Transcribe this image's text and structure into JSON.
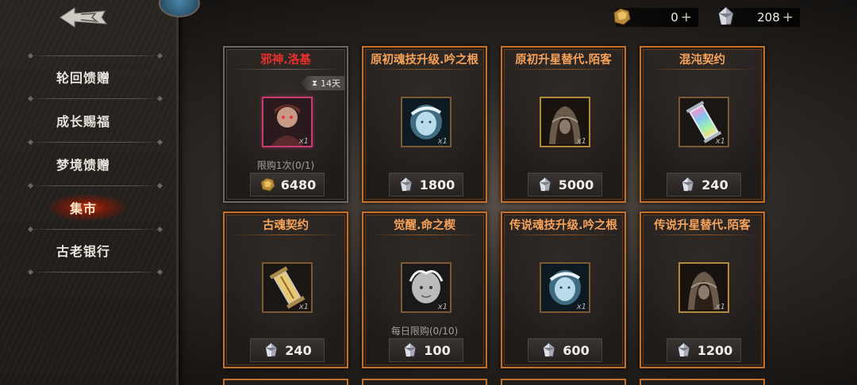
{
  "header": {
    "currencies": [
      {
        "icon": "gold-nugget-icon",
        "amount": "0"
      },
      {
        "icon": "crystal-icon",
        "amount": "208"
      }
    ],
    "plus_label": "+"
  },
  "sidebar": {
    "back_icon": "back-arrow-icon",
    "items": [
      {
        "label": "轮回馈赠",
        "active": false
      },
      {
        "label": "成长赐福",
        "active": false
      },
      {
        "label": "梦境馈赠",
        "active": false
      },
      {
        "label": "集市",
        "active": true
      },
      {
        "label": "古老银行",
        "active": false
      }
    ]
  },
  "shop": {
    "items": [
      {
        "title": "邪神.洛基",
        "featured": true,
        "timer": "14天",
        "quantity": "x1",
        "limit": "限购1次(0/1)",
        "currency": "gold-nugget-icon",
        "price": "6480",
        "art": "portrait-pink"
      },
      {
        "title": "原初魂技升级.吟之根",
        "featured": false,
        "timer": "",
        "quantity": "x1",
        "limit": "",
        "currency": "crystal-icon",
        "price": "1800",
        "art": "blue-face"
      },
      {
        "title": "原初升星替代.陌客",
        "featured": false,
        "timer": "",
        "quantity": "x1",
        "limit": "",
        "currency": "crystal-icon",
        "price": "5000",
        "art": "hooded"
      },
      {
        "title": "混沌契约",
        "featured": false,
        "timer": "",
        "quantity": "x1",
        "limit": "",
        "currency": "crystal-icon",
        "price": "240",
        "art": "rainbow-scroll"
      },
      {
        "title": "古魂契约",
        "featured": false,
        "timer": "",
        "quantity": "x1",
        "limit": "",
        "currency": "crystal-icon",
        "price": "240",
        "art": "gold-scroll"
      },
      {
        "title": "觉醒.命之楔",
        "featured": false,
        "timer": "",
        "quantity": "x1",
        "limit": "每日限购(0/10)",
        "currency": "crystal-icon",
        "price": "100",
        "art": "silver-face"
      },
      {
        "title": "传说魂技升级.吟之根",
        "featured": false,
        "timer": "",
        "quantity": "x1",
        "limit": "",
        "currency": "crystal-icon",
        "price": "600",
        "art": "blue-face"
      },
      {
        "title": "传说升星替代.陌客",
        "featured": false,
        "timer": "",
        "quantity": "x1",
        "limit": "",
        "currency": "crystal-icon",
        "price": "1200",
        "art": "hooded"
      }
    ]
  },
  "colors": {
    "card_border": "#c2702a",
    "title_orange": "#f6a25a",
    "title_red": "#e8302c",
    "active_glow": "#c8320a"
  }
}
